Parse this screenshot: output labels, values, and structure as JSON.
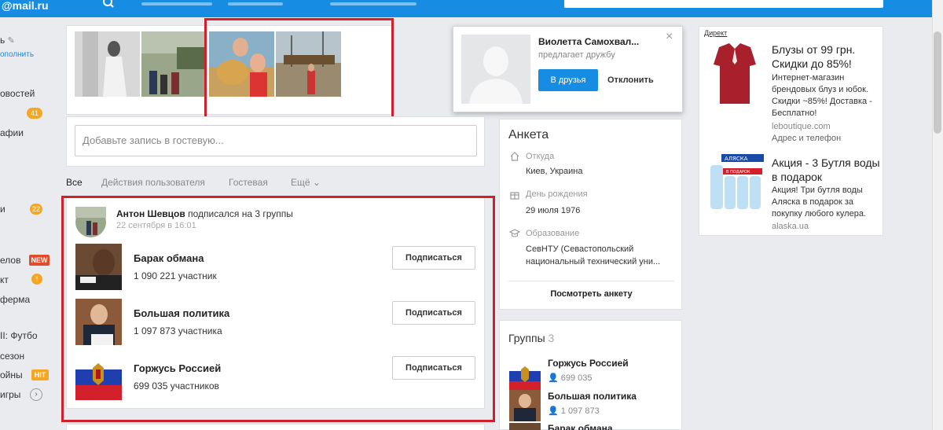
{
  "topbar": {
    "logo": "@mail.ru"
  },
  "leftnav": {
    "items": [
      {
        "label": "ь"
      },
      {
        "label": "ополнить"
      },
      {
        "label": "овостей",
        "badge": "41"
      },
      {
        "label": "афии"
      },
      {
        "label": "и",
        "badge": "22"
      },
      {
        "label": "елов",
        "badge": "NEW"
      },
      {
        "label": "кт",
        "badge": "!"
      },
      {
        "label": "ферма"
      },
      {
        "label": "II: Футбо"
      },
      {
        "label": "сезон"
      },
      {
        "label": "ойны",
        "badge": "HIT"
      },
      {
        "label": "игры"
      }
    ]
  },
  "popup": {
    "name": "Виолетта Самохвал...",
    "subtitle": "предлагает дружбу",
    "accept": "В друзья",
    "decline": "Отклонить"
  },
  "guestbook": {
    "placeholder": "Добавьте запись в гостевую..."
  },
  "filters": {
    "all": "Все",
    "actions": "Действия пользователя",
    "guestbook": "Гостевая",
    "more": "Ещё"
  },
  "feed": {
    "author": "Антон Шевцов",
    "action": "подписался на 3 группы",
    "time": "22 сентября в 16:01",
    "subscribe_label": "Подписаться",
    "groups": [
      {
        "name": "Барак обмана",
        "count": "1 090 221 участник"
      },
      {
        "name": "Большая политика",
        "count": "1 097 873 участника"
      },
      {
        "name": "Горжусь Россией",
        "count": "699 035 участников"
      }
    ]
  },
  "profile": {
    "title": "Анкета",
    "from_label": "Откуда",
    "from_value": "Киев, Украина",
    "birthday_label": "День рождения",
    "birthday_value": "29 июля 1976",
    "education_label": "Образование",
    "education_value": "СевНТУ (Севастопольский национальный технический уни...",
    "view_button": "Посмотреть анкету"
  },
  "groups_panel": {
    "title": "Группы",
    "count": "3",
    "items": [
      {
        "name": "Горжусь Россией",
        "count": "699 035"
      },
      {
        "name": "Большая политика",
        "count": "1 097 873"
      },
      {
        "name": "Барак обмана",
        "count": ""
      }
    ]
  },
  "ads": {
    "label": "Директ",
    "items": [
      {
        "title": "Блузы от 99 грн. Скидки до 85%!",
        "text": "Интернет-магазин брендовых блуз и юбок. Скидки ~85%! Доставка - Бесплатно!",
        "domain": "leboutique.com",
        "extra": "Адрес и телефон"
      },
      {
        "title": "Акция - 3 Бутля воды в подарок",
        "text": "Акция! Три бутля воды Аляска в подарок за покупку любого кулера.",
        "domain": "alaska.ua",
        "logo_text": "АЛЯСКА",
        "banner_text": "В ПОДАРОК"
      }
    ]
  },
  "colors": {
    "brand": "#168de2",
    "highlight": "#d0202b"
  }
}
